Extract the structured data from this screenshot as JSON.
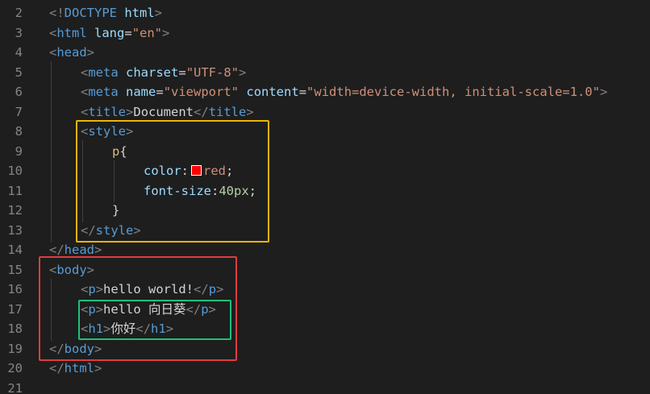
{
  "lines": [
    {
      "n": "2",
      "indent": 0,
      "segs": [
        [
          "br",
          "<!"
        ],
        [
          "tag",
          "DOCTYPE"
        ],
        [
          "txt",
          " "
        ],
        [
          "attr",
          "html"
        ],
        [
          "br",
          ">"
        ]
      ]
    },
    {
      "n": "3",
      "indent": 0,
      "segs": [
        [
          "br",
          "<"
        ],
        [
          "tag",
          "html"
        ],
        [
          "txt",
          " "
        ],
        [
          "attr",
          "lang"
        ],
        [
          "txt",
          "="
        ],
        [
          "str",
          "\"en\""
        ],
        [
          "br",
          ">"
        ]
      ]
    },
    {
      "n": "4",
      "indent": 0,
      "segs": [
        [
          "br",
          "<"
        ],
        [
          "tag",
          "head"
        ],
        [
          "br",
          ">"
        ]
      ]
    },
    {
      "n": "5",
      "indent": 1,
      "segs": [
        [
          "br",
          "<"
        ],
        [
          "tag",
          "meta"
        ],
        [
          "txt",
          " "
        ],
        [
          "attr",
          "charset"
        ],
        [
          "txt",
          "="
        ],
        [
          "str",
          "\"UTF-8\""
        ],
        [
          "br",
          ">"
        ]
      ]
    },
    {
      "n": "6",
      "indent": 1,
      "segs": [
        [
          "br",
          "<"
        ],
        [
          "tag",
          "meta"
        ],
        [
          "txt",
          " "
        ],
        [
          "attr",
          "name"
        ],
        [
          "txt",
          "="
        ],
        [
          "str",
          "\"viewport\""
        ],
        [
          "txt",
          " "
        ],
        [
          "attr",
          "content"
        ],
        [
          "txt",
          "="
        ],
        [
          "str",
          "\"width=device-width, initial-scale=1.0\""
        ],
        [
          "br",
          ">"
        ]
      ]
    },
    {
      "n": "7",
      "indent": 1,
      "segs": [
        [
          "br",
          "<"
        ],
        [
          "tag",
          "title"
        ],
        [
          "br",
          ">"
        ],
        [
          "txt",
          "Document"
        ],
        [
          "br",
          "</"
        ],
        [
          "tag",
          "title"
        ],
        [
          "br",
          ">"
        ]
      ]
    },
    {
      "n": "8",
      "indent": 1,
      "segs": [
        [
          "br",
          "<"
        ],
        [
          "tag",
          "style"
        ],
        [
          "br",
          ">"
        ]
      ]
    },
    {
      "n": "9",
      "indent": 2,
      "segs": [
        [
          "sel",
          "p"
        ],
        [
          "txt",
          "{"
        ]
      ]
    },
    {
      "n": "10",
      "indent": 3,
      "segs": [
        [
          "prop",
          "color"
        ],
        [
          "txt",
          ":"
        ],
        [
          "swatch",
          "#ff0000"
        ],
        [
          "str",
          "red"
        ],
        [
          "txt",
          ";"
        ]
      ]
    },
    {
      "n": "11",
      "indent": 3,
      "segs": [
        [
          "prop",
          "font-size"
        ],
        [
          "txt",
          ":"
        ],
        [
          "num",
          "40px"
        ],
        [
          "txt",
          ";"
        ]
      ]
    },
    {
      "n": "12",
      "indent": 2,
      "segs": [
        [
          "txt",
          "}"
        ]
      ]
    },
    {
      "n": "13",
      "indent": 1,
      "segs": [
        [
          "br",
          "</"
        ],
        [
          "tag",
          "style"
        ],
        [
          "br",
          ">"
        ]
      ]
    },
    {
      "n": "14",
      "indent": 0,
      "segs": [
        [
          "br",
          "</"
        ],
        [
          "tag",
          "head"
        ],
        [
          "br",
          ">"
        ]
      ]
    },
    {
      "n": "15",
      "indent": 0,
      "segs": [
        [
          "br",
          "<"
        ],
        [
          "tag",
          "body"
        ],
        [
          "br",
          ">"
        ]
      ]
    },
    {
      "n": "16",
      "indent": 1,
      "segs": [
        [
          "br",
          "<"
        ],
        [
          "tag",
          "p"
        ],
        [
          "br",
          ">"
        ],
        [
          "txt",
          "hello world!"
        ],
        [
          "br",
          "</"
        ],
        [
          "tag",
          "p"
        ],
        [
          "br",
          ">"
        ]
      ]
    },
    {
      "n": "17",
      "indent": 1,
      "segs": [
        [
          "br",
          "<"
        ],
        [
          "tag",
          "p"
        ],
        [
          "br",
          ">"
        ],
        [
          "txt",
          "hello 向日葵"
        ],
        [
          "br",
          "</"
        ],
        [
          "tag",
          "p"
        ],
        [
          "br",
          ">"
        ]
      ]
    },
    {
      "n": "18",
      "indent": 1,
      "segs": [
        [
          "br",
          "<"
        ],
        [
          "tag",
          "h1"
        ],
        [
          "br",
          ">"
        ],
        [
          "txt",
          "你好"
        ],
        [
          "br",
          "</"
        ],
        [
          "tag",
          "h1"
        ],
        [
          "br",
          ">"
        ]
      ]
    },
    {
      "n": "19",
      "indent": 0,
      "segs": [
        [
          "br",
          "</"
        ],
        [
          "tag",
          "body"
        ],
        [
          "br",
          ">"
        ]
      ]
    },
    {
      "n": "20",
      "indent": 0,
      "segs": [
        [
          "br",
          "</"
        ],
        [
          "tag",
          "html"
        ],
        [
          "br",
          ">"
        ]
      ]
    },
    {
      "n": "21",
      "indent": 0,
      "segs": []
    }
  ],
  "highlights": {
    "style_box_color": "#f0b400",
    "body_box_color": "#e03c3c",
    "content_box_color": "#1fbf7a"
  }
}
